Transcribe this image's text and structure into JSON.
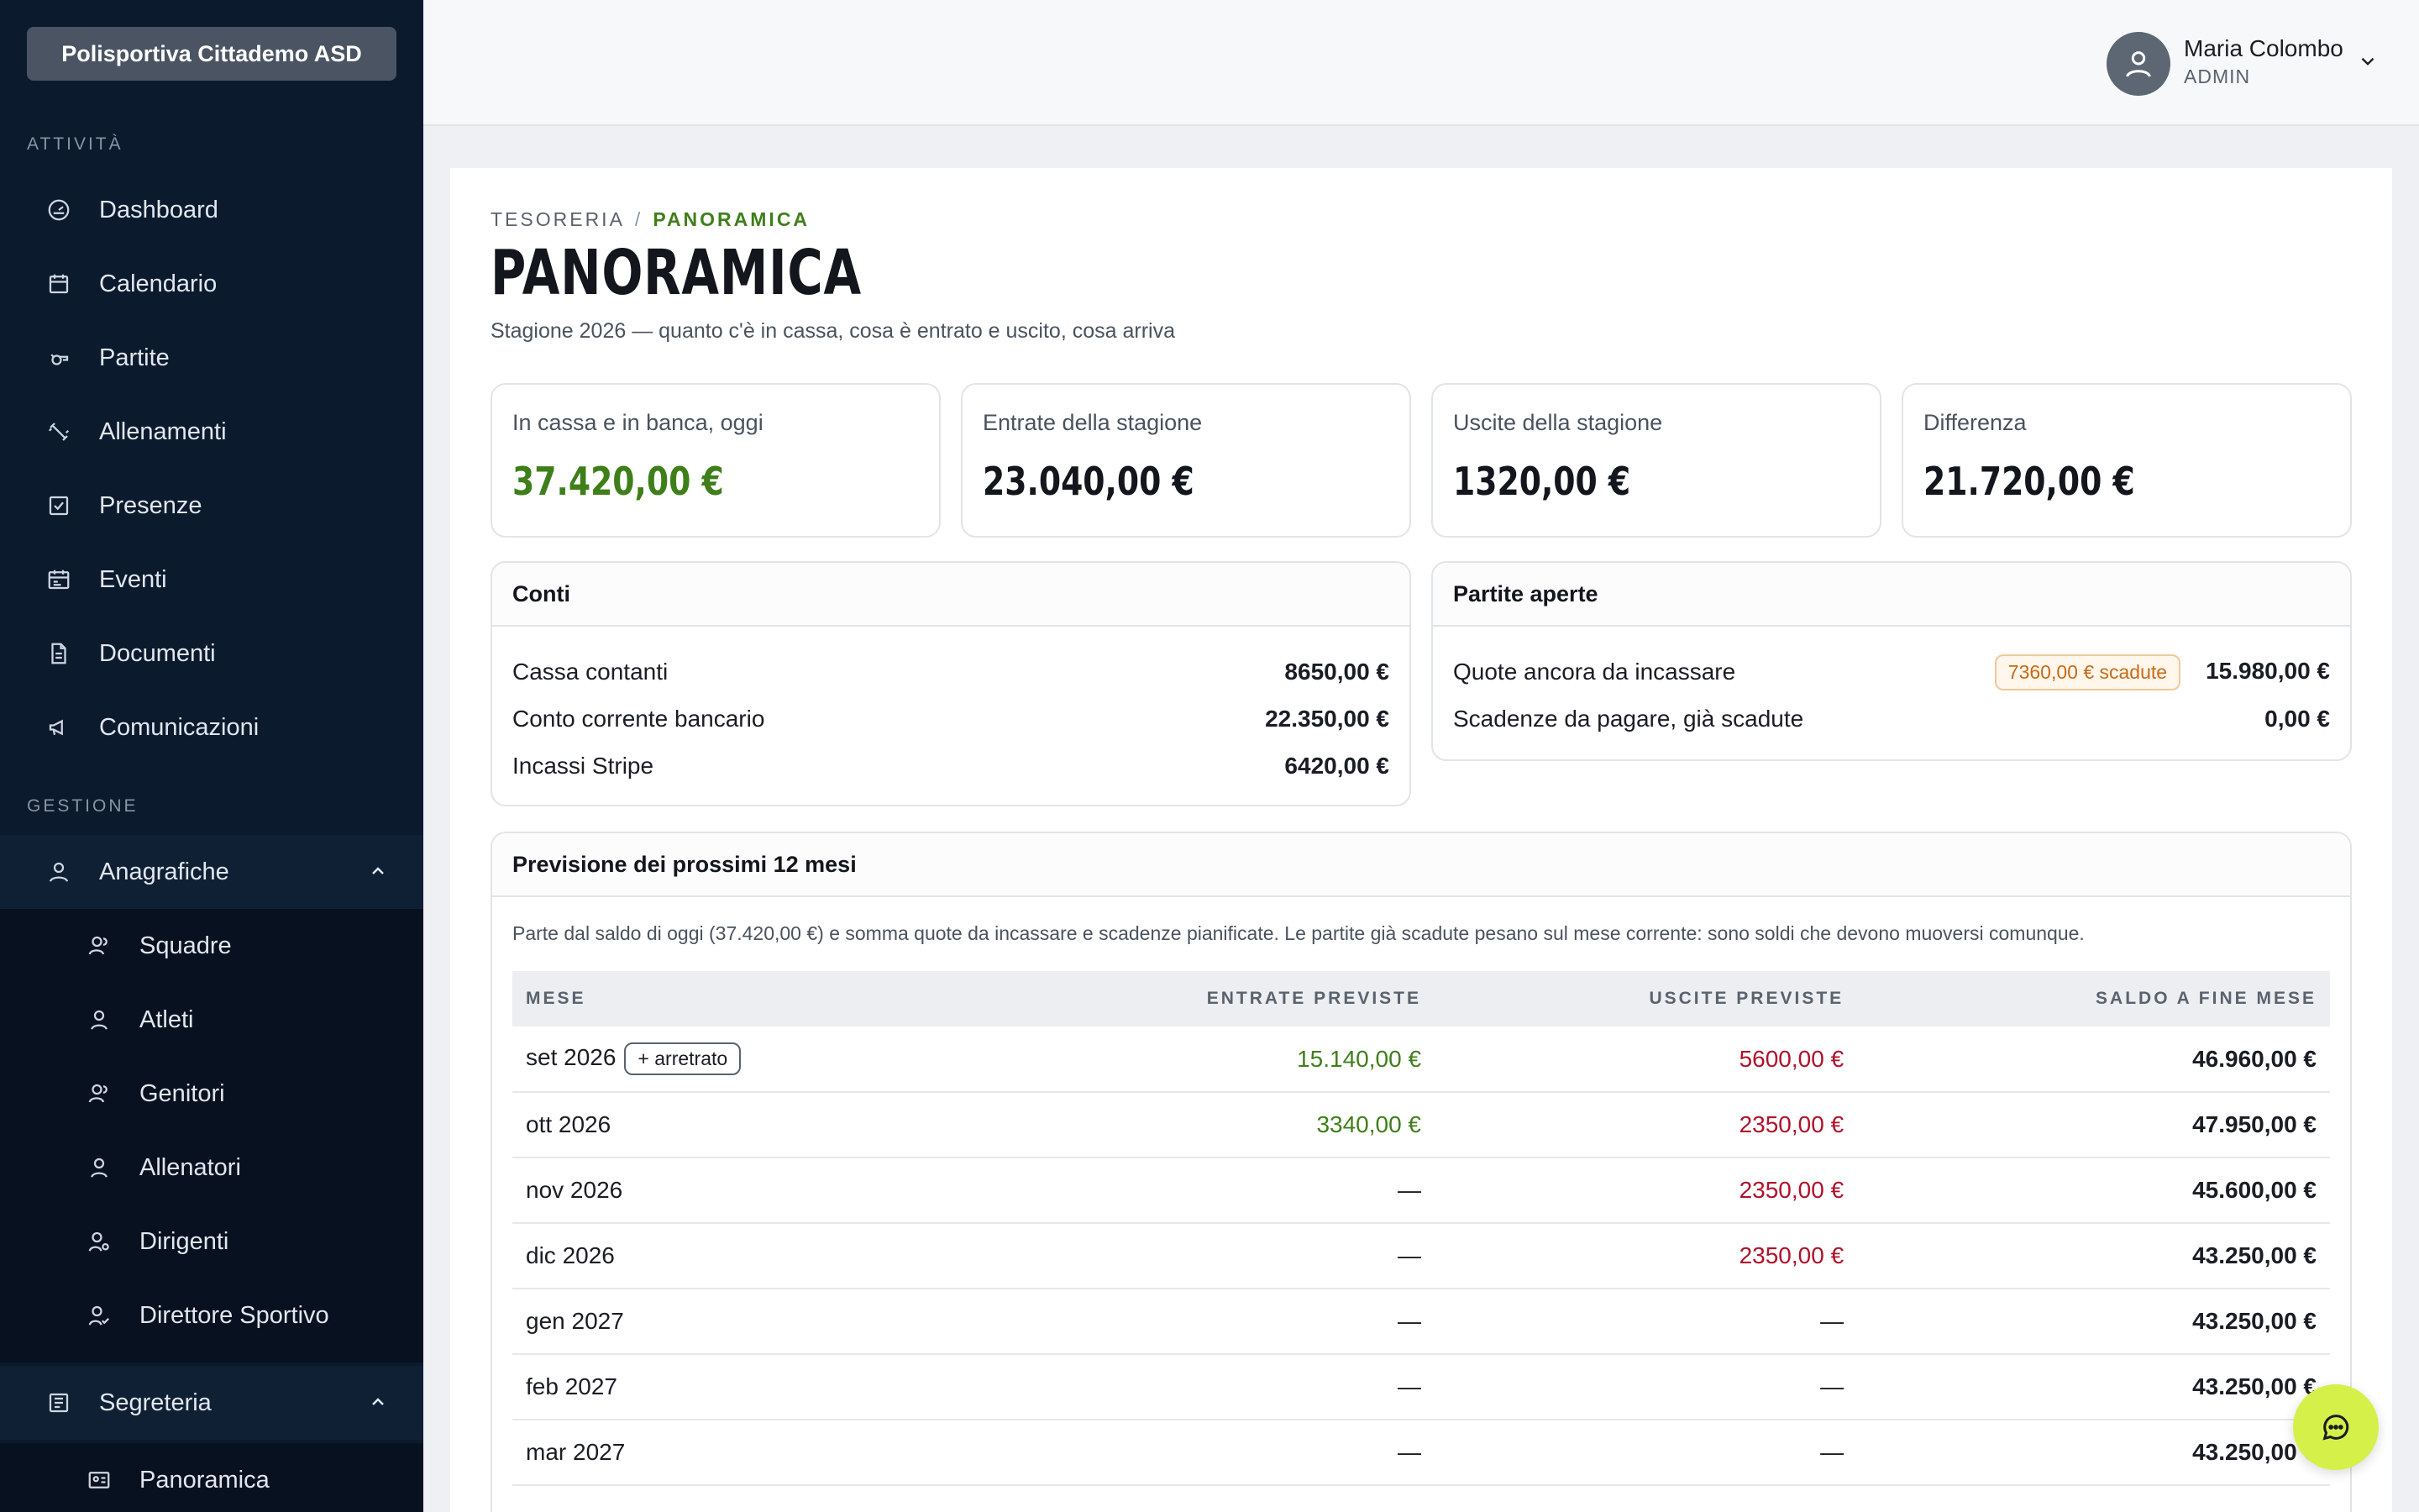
{
  "org": {
    "name": "Polisportiva Cittademo ASD"
  },
  "sidebar": {
    "section_activity": "ATTIVITÀ",
    "section_management": "GESTIONE",
    "activity_items": [
      {
        "label": "Dashboard",
        "icon": "gauge-icon"
      },
      {
        "label": "Calendario",
        "icon": "calendar-icon"
      },
      {
        "label": "Partite",
        "icon": "whistle-icon"
      },
      {
        "label": "Allenamenti",
        "icon": "dumbbell-icon"
      },
      {
        "label": "Presenze",
        "icon": "checkbox-icon"
      },
      {
        "label": "Eventi",
        "icon": "calendar-event-icon"
      },
      {
        "label": "Documenti",
        "icon": "document-icon"
      },
      {
        "label": "Comunicazioni",
        "icon": "megaphone-icon"
      }
    ],
    "anagrafiche": {
      "label": "Anagrafiche",
      "items": [
        {
          "label": "Squadre"
        },
        {
          "label": "Atleti"
        },
        {
          "label": "Genitori"
        },
        {
          "label": "Allenatori"
        },
        {
          "label": "Dirigenti"
        },
        {
          "label": "Direttore Sportivo"
        }
      ]
    },
    "segreteria": {
      "label": "Segreteria",
      "items": [
        {
          "label": "Panoramica"
        }
      ]
    }
  },
  "user": {
    "name": "Maria Colombo",
    "role": "ADMIN"
  },
  "breadcrumb": {
    "parent": "TESORERIA",
    "sep": "/",
    "current": "PANORAMICA"
  },
  "page": {
    "title": "PANORAMICA",
    "subtitle": "Stagione 2026 — quanto c'è in cassa, cosa è entrato e uscito, cosa arriva"
  },
  "stats": [
    {
      "label": "In cassa e in banca, oggi",
      "value": "37.420,00 €"
    },
    {
      "label": "Entrate della stagione",
      "value": "23.040,00 €"
    },
    {
      "label": "Uscite della stagione",
      "value": "1320,00 €"
    },
    {
      "label": "Differenza",
      "value": "21.720,00 €"
    }
  ],
  "accounts": {
    "title": "Conti",
    "rows": [
      {
        "label": "Cassa contanti",
        "amount": "8650,00 €"
      },
      {
        "label": "Conto corrente bancario",
        "amount": "22.350,00 €"
      },
      {
        "label": "Incassi Stripe",
        "amount": "6420,00 €"
      }
    ]
  },
  "open_items": {
    "title": "Partite aperte",
    "rows": [
      {
        "label": "Quote ancora da incassare",
        "badge": "7360,00 € scadute",
        "amount": "15.980,00 €"
      },
      {
        "label": "Scadenze da pagare, già scadute",
        "amount": "0,00 €"
      }
    ]
  },
  "forecast": {
    "title": "Previsione dei prossimi 12 mesi",
    "note": "Parte dal saldo di oggi (37.420,00 €) e somma quote da incassare e scadenze pianificate. Le partite già scadute pesano sul mese corrente: sono soldi che devono muoversi comunque.",
    "columns": [
      "MESE",
      "ENTRATE PREVISTE",
      "USCITE PREVISTE",
      "SALDO A FINE MESE"
    ],
    "arrears_tag": "+ arretrato",
    "rows": [
      {
        "month": "set 2026",
        "in": "15.140,00 €",
        "out": "5600,00 €",
        "balance": "46.960,00 €"
      },
      {
        "month": "ott 2026",
        "in": "3340,00 €",
        "out": "2350,00 €",
        "balance": "47.950,00 €"
      },
      {
        "month": "nov 2026",
        "in": "—",
        "out": "2350,00 €",
        "balance": "45.600,00 €"
      },
      {
        "month": "dic 2026",
        "in": "—",
        "out": "2350,00 €",
        "balance": "43.250,00 €"
      },
      {
        "month": "gen 2027",
        "in": "—",
        "out": "—",
        "balance": "43.250,00 €"
      },
      {
        "month": "feb 2027",
        "in": "—",
        "out": "—",
        "balance": "43.250,00 €"
      },
      {
        "month": "mar 2027",
        "in": "—",
        "out": "—",
        "balance": "43.250,00 €"
      }
    ]
  },
  "colors": {
    "sidebar": "#0c1a2e",
    "accent_green": "#3f7f1a",
    "negative_red": "#b0122a",
    "chat_fab": "#d6f04a"
  }
}
